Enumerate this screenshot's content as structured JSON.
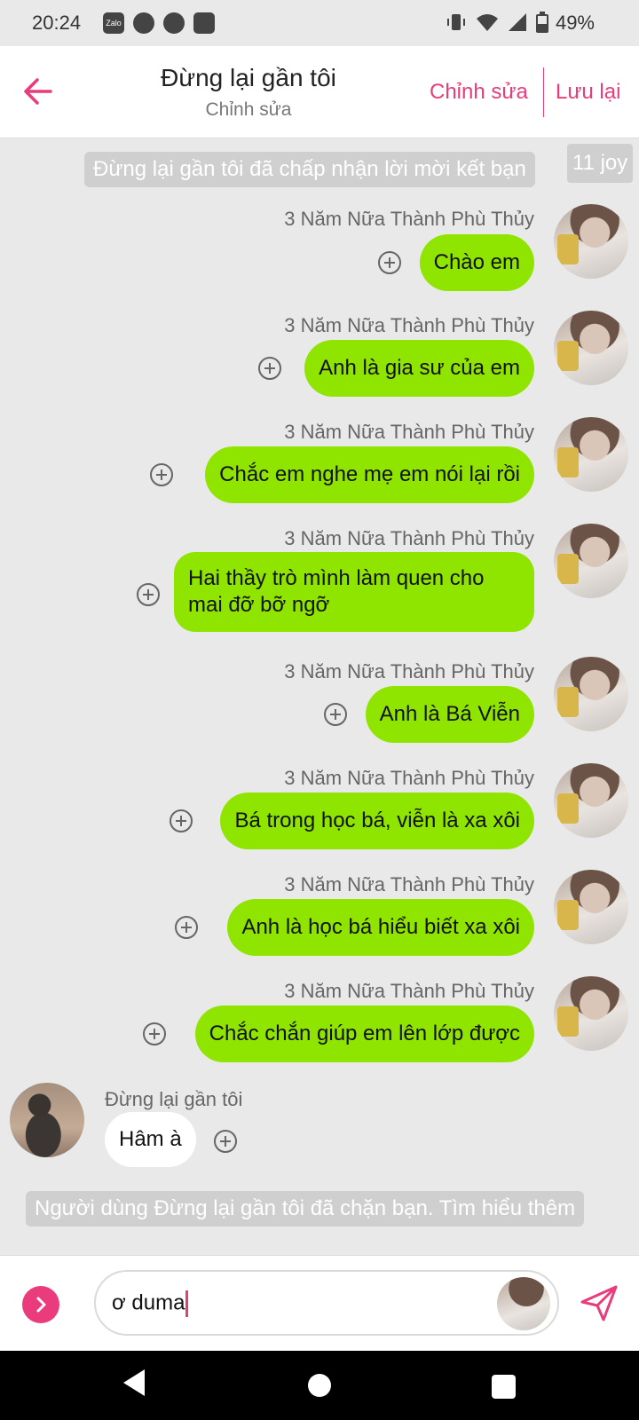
{
  "status_bar": {
    "time": "20:24",
    "battery": "49%",
    "app_icons": [
      "Zalo",
      "messenger-icon",
      "facebook-icon",
      "storage-warning-icon"
    ],
    "system_icons": [
      "vibrate-icon",
      "wifi-icon",
      "signal-icon",
      "battery-icon"
    ]
  },
  "header": {
    "title": "Đừng lại gần tôi",
    "subtitle": "Chỉnh sửa",
    "edit_label": "Chỉnh sửa",
    "save_label": "Lưu lại",
    "accent": "#e93c7a"
  },
  "notices": {
    "accepted": "Đừng lại gần tôi đã chấp nhận lời mời kết bạn",
    "joy": "11 joy",
    "blocked": "Người dùng Đừng lại gần tôi đã chặn bạn. Tìm hiểu thêm"
  },
  "outgoing": [
    {
      "sender": "3 Năm Nữa Thành Phù Thủy",
      "text": "Chào em"
    },
    {
      "sender": "3 Năm Nữa Thành Phù Thủy",
      "text": "Anh là gia sư của em"
    },
    {
      "sender": "3 Năm Nữa Thành Phù Thủy",
      "text": "Chắc em nghe mẹ em nói lại rồi"
    },
    {
      "sender": "3 Năm Nữa Thành Phù Thủy",
      "text": "Hai thầy trò mình làm quen cho mai đỡ bỡ ngỡ"
    },
    {
      "sender": "3 Năm Nữa Thành Phù Thủy",
      "text": "Anh là Bá Viễn"
    },
    {
      "sender": "3 Năm Nữa Thành Phù Thủy",
      "text": "Bá trong học bá, viễn là xa xôi"
    },
    {
      "sender": "3 Năm Nữa Thành Phù Thủy",
      "text": "Anh là học bá hiểu biết xa xôi"
    },
    {
      "sender": "3 Năm Nữa Thành Phù Thủy",
      "text": "Chắc chắn giúp em lên lớp được"
    }
  ],
  "incoming": {
    "sender": "Đừng lại gần tôi",
    "text": "Hâm à"
  },
  "composer": {
    "value": "ơ duma"
  },
  "colors": {
    "outgoing_bubble": "#8fe400",
    "incoming_bubble": "#ffffff",
    "chat_background": "#e9e9e9"
  }
}
